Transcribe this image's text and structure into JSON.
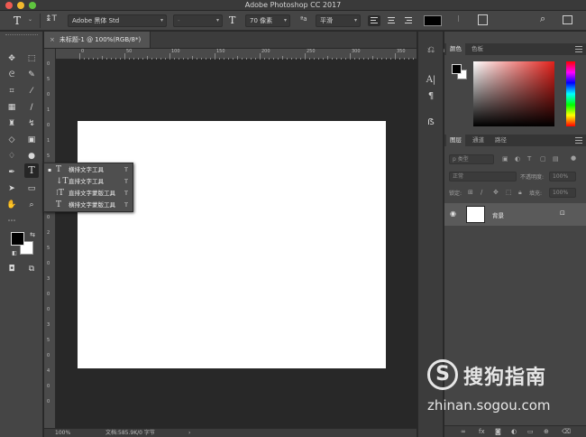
{
  "app": {
    "title": "Adobe Photoshop CC 2017"
  },
  "optionsbar": {
    "tool_glyph": "T",
    "orient_glyph": "↨T",
    "font_family": "Adobe 黑体 Std",
    "font_style": "-",
    "size_glyph": "T",
    "font_size": "70 像素",
    "aa_glyph": "ªa",
    "antialias": "平滑",
    "warp_glyph": "Ⅰ",
    "text_color": "#000000"
  },
  "document": {
    "tab_close": "×",
    "tab_title": "未标题-1 @ 100%(RGB/8*)",
    "zoom": "100%",
    "status": "文档:585.9K/0 字节",
    "arrow": "›"
  },
  "ruler": {
    "top": [
      "0",
      "50",
      "100",
      "150",
      "200",
      "250",
      "300",
      "350",
      "400"
    ],
    "left": [
      "0",
      "5",
      "0",
      "1",
      "0",
      "1",
      "5",
      "0",
      "2",
      "0",
      "0",
      "2",
      "5",
      "0",
      "3",
      "0",
      "0",
      "3",
      "5",
      "0",
      "4",
      "0",
      "0"
    ]
  },
  "flyout": {
    "items": [
      {
        "icon": "T",
        "label": "横排文字工具",
        "key": "T",
        "current": "▪"
      },
      {
        "icon": "↓T",
        "label": "直排文字工具",
        "key": "T",
        "current": ""
      },
      {
        "icon": "⁝T",
        "label": "直排文字蒙版工具",
        "key": "T",
        "current": ""
      },
      {
        "icon": "T",
        "label": "横排文字蒙版工具",
        "key": "T",
        "current": ""
      }
    ]
  },
  "color_panel": {
    "tabs": [
      "颜色",
      "色板"
    ],
    "fg": "#000000",
    "bg": "#ffffff"
  },
  "layers_panel": {
    "tabs": [
      "图层",
      "通道",
      "路径"
    ],
    "filter": "p 类型",
    "blend": "正常",
    "opacity_label": "不透明度:",
    "opacity": "100%",
    "lock_label": "锁定:",
    "fill_label": "填充:",
    "fill": "100%",
    "layer_name": "背景"
  },
  "watermark": {
    "logo": "S",
    "name": "搜狗指南",
    "url": "zhinan.sogou.com"
  },
  "colors": {
    "accent_red": "#e3211b",
    "panel": "#454545",
    "canvas": "#ffffff"
  }
}
